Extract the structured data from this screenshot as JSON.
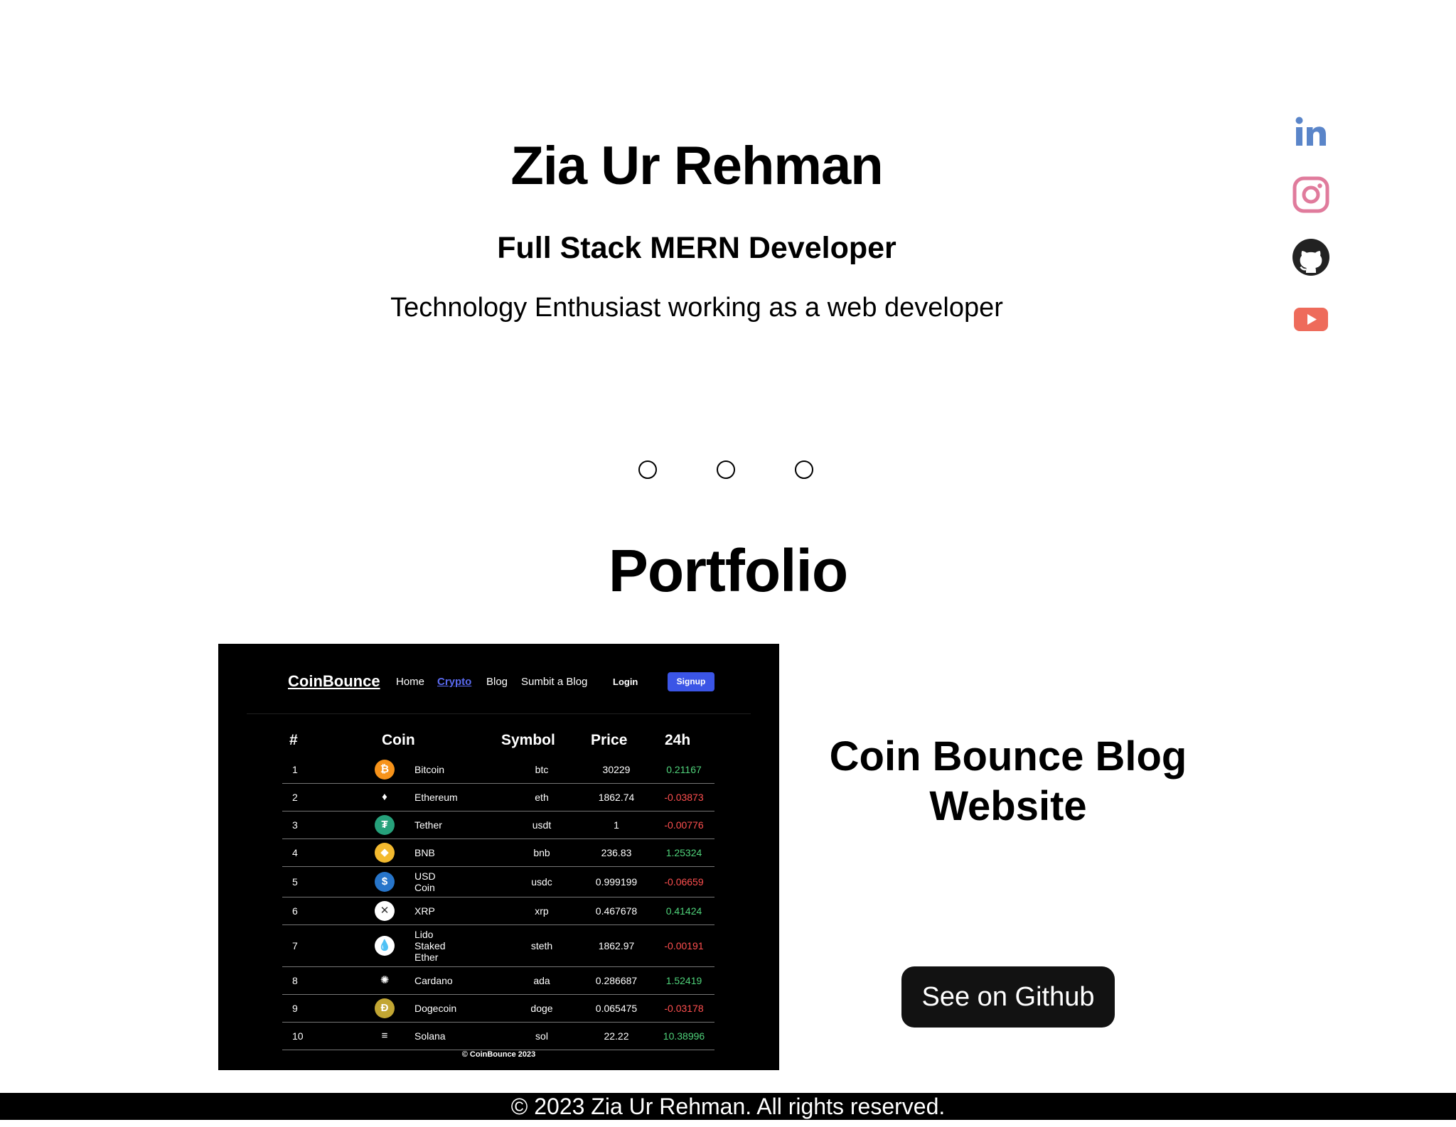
{
  "hero": {
    "name": "Zia Ur Rehman",
    "role": "Full Stack MERN Developer",
    "tagline": "Technology Enthusiast working as a web developer"
  },
  "social": [
    {
      "icon": "linkedin-icon",
      "color": "#5a85c9"
    },
    {
      "icon": "instagram-icon",
      "color": "#e07b9c"
    },
    {
      "icon": "github-icon",
      "color": "#222222"
    },
    {
      "icon": "youtube-icon",
      "color": "#ee6b5b"
    }
  ],
  "portfolio": {
    "title": "Portfolio",
    "project": {
      "title": "Coin Bounce Blog Website",
      "button_label": "See on Github"
    },
    "preview": {
      "logo": "CoinBounce",
      "nav": [
        "Home",
        "Crypto",
        "Blog",
        "Sumbit a Blog"
      ],
      "active_nav": "Crypto",
      "login": "Login",
      "signup": "Signup",
      "headers": [
        "#",
        "Coin",
        "Symbol",
        "Price",
        "24h"
      ],
      "rows": [
        {
          "rank": "1",
          "name": "Bitcoin",
          "symbol": "btc",
          "price": "30229",
          "change": "0.21167",
          "icon_color": "#f7931a",
          "icon_glyph": "₿"
        },
        {
          "rank": "2",
          "name": "Ethereum",
          "symbol": "eth",
          "price": "1862.74",
          "change": "-0.03873",
          "icon_color": "#000000",
          "icon_glyph": "♦"
        },
        {
          "rank": "3",
          "name": "Tether",
          "symbol": "usdt",
          "price": "1",
          "change": "-0.00776",
          "icon_color": "#26a17b",
          "icon_glyph": "₮"
        },
        {
          "rank": "4",
          "name": "BNB",
          "symbol": "bnb",
          "price": "236.83",
          "change": "1.25324",
          "icon_color": "#f3ba2f",
          "icon_glyph": "◆"
        },
        {
          "rank": "5",
          "name": "USD\nCoin",
          "symbol": "usdc",
          "price": "0.999199",
          "change": "-0.06659",
          "icon_color": "#2775ca",
          "icon_glyph": "$"
        },
        {
          "rank": "6",
          "name": "XRP",
          "symbol": "xrp",
          "price": "0.467678",
          "change": "0.41424",
          "icon_color": "#ffffff",
          "icon_glyph": "✕"
        },
        {
          "rank": "7",
          "name": "Lido\nStaked\nEther",
          "symbol": "steth",
          "price": "1862.97",
          "change": "-0.00191",
          "icon_color": "#ffffff",
          "icon_glyph": "💧"
        },
        {
          "rank": "8",
          "name": "Cardano",
          "symbol": "ada",
          "price": "0.286687",
          "change": "1.52419",
          "icon_color": "#000000",
          "icon_glyph": "✺"
        },
        {
          "rank": "9",
          "name": "Dogecoin",
          "symbol": "doge",
          "price": "0.065475",
          "change": "-0.03178",
          "icon_color": "#c2a633",
          "icon_glyph": "Ð"
        },
        {
          "rank": "10",
          "name": "Solana",
          "symbol": "sol",
          "price": "22.22",
          "change": "10.38996",
          "icon_color": "#000000",
          "icon_glyph": "≡"
        }
      ],
      "footer": "© CoinBounce 2023"
    }
  },
  "footer": {
    "text": "© 2023 Zia Ur Rehman. All rights reserved."
  }
}
